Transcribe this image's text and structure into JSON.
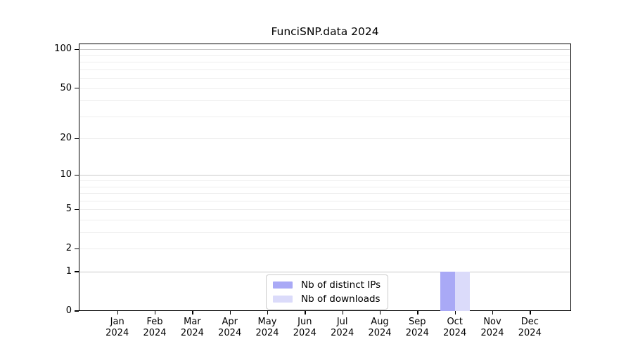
{
  "title": "FunciSNP.data 2024",
  "chart_data": {
    "type": "bar",
    "title": "FunciSNP.data 2024",
    "categories": [
      "Jan",
      "Feb",
      "Mar",
      "Apr",
      "May",
      "Jun",
      "Jul",
      "Aug",
      "Sep",
      "Oct",
      "Nov",
      "Dec"
    ],
    "year_label": "2024",
    "series": [
      {
        "name": "Nb of distinct IPs",
        "color": "#a9a9f6",
        "values": [
          0,
          0,
          0,
          0,
          0,
          0,
          0,
          0,
          0,
          1,
          0,
          0
        ]
      },
      {
        "name": "Nb of downloads",
        "color": "#dbdbfa",
        "values": [
          0,
          0,
          0,
          0,
          0,
          0,
          0,
          0,
          0,
          1,
          0,
          0
        ]
      }
    ],
    "yticks": [
      0,
      1,
      2,
      5,
      10,
      20,
      50,
      100
    ],
    "major_gridlines": [
      1,
      10,
      100
    ],
    "minor_gridlines": [
      2,
      3,
      4,
      5,
      6,
      7,
      8,
      9,
      20,
      30,
      40,
      50,
      60,
      70,
      80,
      90
    ],
    "scale": "log1p",
    "ylim": [
      0,
      111
    ],
    "xlabel": "",
    "ylabel": "",
    "grid": "horizontal",
    "legend_position": "bottom-center",
    "colors": {
      "axis": "#000000",
      "major_grid": "#c8c8c8",
      "minor_grid": "#ededed",
      "background": "#ffffff"
    }
  }
}
